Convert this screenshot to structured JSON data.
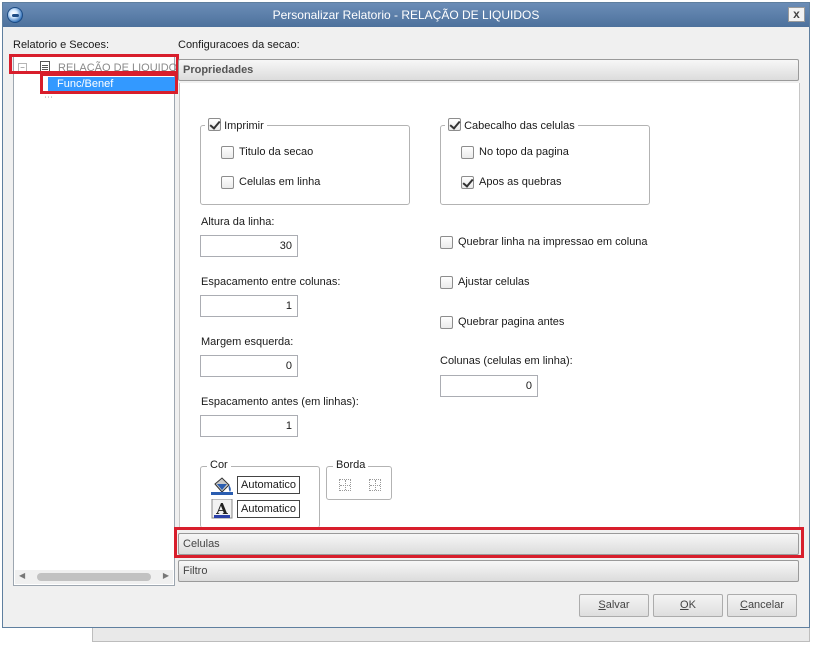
{
  "window": {
    "title": "Personalizar Relatorio - RELAÇÃO DE LIQUIDOS",
    "close_label": "x"
  },
  "left_panel": {
    "label": "Relatorio e Secoes:",
    "tree_root": "RELAÇÃO DE LIQUIDOS",
    "tree_expander": "−",
    "tree_child": "Func/Benef"
  },
  "right_panel": {
    "label": "Configuracoes da secao:",
    "properties_header": "Propriedades",
    "cells_header": "Celulas",
    "filter_header": "Filtro"
  },
  "print_group": {
    "label": "Imprimir",
    "checked": true,
    "options": [
      {
        "label": "Titulo da secao",
        "checked": false
      },
      {
        "label": "Celulas em linha",
        "checked": false
      }
    ]
  },
  "header_group": {
    "label": "Cabecalho das celulas",
    "checked": true,
    "options": [
      {
        "label": "No topo da pagina",
        "checked": false
      },
      {
        "label": "Apos as quebras",
        "checked": true
      }
    ]
  },
  "fields": {
    "line_height": {
      "label": "Altura da linha:",
      "value": "30"
    },
    "column_spacing": {
      "label": "Espacamento entre colunas:",
      "value": "1"
    },
    "left_margin": {
      "label": "Margem esquerda:",
      "value": "0"
    },
    "spacing_before": {
      "label": "Espacamento antes (em linhas):",
      "value": "1"
    },
    "columns": {
      "label": "Colunas (celulas em linha):",
      "value": "0"
    }
  },
  "right_options": [
    {
      "label": "Quebrar linha na impressao em coluna",
      "checked": false
    },
    {
      "label": "Ajustar celulas",
      "checked": false
    },
    {
      "label": "Quebrar pagina antes",
      "checked": false
    }
  ],
  "color_group": {
    "label": "Cor",
    "fill_value": "Automatico",
    "font_value": "Automatico"
  },
  "border_group": {
    "label": "Borda"
  },
  "buttons": {
    "save": {
      "prefix": "",
      "accel": "S",
      "rest": "alvar"
    },
    "ok": {
      "prefix": "",
      "accel": "O",
      "rest": "K"
    },
    "cancel": {
      "prefix": "",
      "accel": "C",
      "rest": "ancelar"
    }
  },
  "colors": {
    "title_bar": "#5a7ea9",
    "selection": "#3399ff",
    "highlight_red": "#d81e2c"
  }
}
